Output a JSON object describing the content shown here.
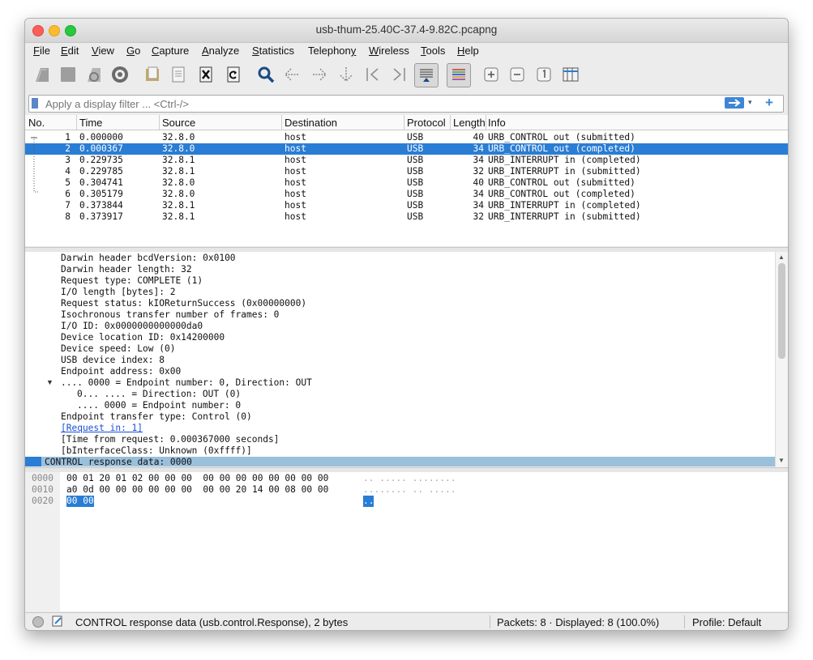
{
  "window": {
    "title": "usb-thum-25.40C-37.4-9.82C.pcapng"
  },
  "menu": [
    {
      "label": "File",
      "u": "F",
      "rest": "ile"
    },
    {
      "label": "Edit",
      "u": "E",
      "rest": "dit"
    },
    {
      "label": "View",
      "u": "V",
      "rest": "iew"
    },
    {
      "label": "Go",
      "u": "G",
      "rest": "o"
    },
    {
      "label": "Capture",
      "u": "C",
      "rest": "apture"
    },
    {
      "label": "Analyze",
      "u": "A",
      "rest": "nalyze"
    },
    {
      "label": "Statistics",
      "u": "S",
      "rest": "tatistics"
    },
    {
      "label": "Telephony",
      "u": "",
      "rest": "Telephon",
      "u2": "y"
    },
    {
      "label": "Wireless",
      "u": "W",
      "rest": "ireless"
    },
    {
      "label": "Tools",
      "u": "T",
      "rest": "ools"
    },
    {
      "label": "Help",
      "u": "H",
      "rest": "elp"
    }
  ],
  "toolbar_icons": [
    "start-capture-icon",
    "stop-capture-icon",
    "restart-capture-icon",
    "capture-options-icon",
    "open-file-icon",
    "save-file-icon",
    "close-file-icon",
    "reload-file-icon",
    "find-packet-icon",
    "go-back-icon",
    "go-forward-icon",
    "go-to-packet-icon",
    "first-packet-icon",
    "last-packet-icon",
    "auto-scroll-icon",
    "colorize-icon",
    "zoom-in-icon",
    "zoom-out-icon",
    "normal-size-icon",
    "resize-columns-icon"
  ],
  "filter": {
    "placeholder": "Apply a display filter ... <Ctrl-/>"
  },
  "packet_list": {
    "columns": [
      "No.",
      "Time",
      "Source",
      "Destination",
      "Protocol",
      "Length",
      "Info"
    ],
    "rows": [
      {
        "no": "1",
        "time": "0.000000",
        "src": "32.8.0",
        "dst": "host",
        "proto": "USB",
        "len": "40",
        "info": "URB_CONTROL out (submitted)"
      },
      {
        "no": "2",
        "time": "0.000367",
        "src": "32.8.0",
        "dst": "host",
        "proto": "USB",
        "len": "34",
        "info": "URB_CONTROL out (completed)"
      },
      {
        "no": "3",
        "time": "0.229735",
        "src": "32.8.1",
        "dst": "host",
        "proto": "USB",
        "len": "34",
        "info": "URB_INTERRUPT in (completed)"
      },
      {
        "no": "4",
        "time": "0.229785",
        "src": "32.8.1",
        "dst": "host",
        "proto": "USB",
        "len": "32",
        "info": "URB_INTERRUPT in (submitted)"
      },
      {
        "no": "5",
        "time": "0.304741",
        "src": "32.8.0",
        "dst": "host",
        "proto": "USB",
        "len": "40",
        "info": "URB_CONTROL out (submitted)"
      },
      {
        "no": "6",
        "time": "0.305179",
        "src": "32.8.0",
        "dst": "host",
        "proto": "USB",
        "len": "34",
        "info": "URB_CONTROL out (completed)"
      },
      {
        "no": "7",
        "time": "0.373844",
        "src": "32.8.1",
        "dst": "host",
        "proto": "USB",
        "len": "34",
        "info": "URB_INTERRUPT in (completed)"
      },
      {
        "no": "8",
        "time": "0.373917",
        "src": "32.8.1",
        "dst": "host",
        "proto": "USB",
        "len": "32",
        "info": "URB_INTERRUPT in (submitted)"
      }
    ],
    "selected_row": 2
  },
  "details": {
    "lines": [
      "Darwin header bcdVersion: 0x0100",
      "Darwin header length: 32",
      "Request type: COMPLETE (1)",
      "I/O length [bytes]: 2",
      "Request status: kIOReturnSuccess (0x00000000)",
      "Isochronous transfer number of frames: 0",
      "I/O ID: 0x0000000000000da0",
      "Device location ID: 0x14200000",
      "Device speed: Low (0)",
      "USB device index: 8",
      "Endpoint address: 0x00",
      ".... 0000 = Endpoint number: 0, Direction: OUT",
      "0... .... = Direction: OUT (0)",
      ".... 0000 = Endpoint number: 0",
      "Endpoint transfer type: Control (0)",
      "[Request in: 1]",
      "[Time from request: 0.000367000 seconds]",
      "[bInterfaceClass: Unknown (0xffff)]",
      "CONTROL response data: 0000"
    ]
  },
  "bytes": {
    "rows": [
      {
        "offset": "0000",
        "hex": "00 01 20 01 02 00 00 00  00 00 00 00 00 00 00 00",
        "ascii": ".. ..... ........"
      },
      {
        "offset": "0010",
        "hex": "a0 0d 00 00 00 00 00 00  00 00 20 14 00 08 00 00",
        "ascii": "........ .. ....."
      },
      {
        "offset": "0020",
        "hex": "00 00",
        "ascii": ".."
      }
    ]
  },
  "status": {
    "field": "CONTROL response data (usb.control.Response), 2 bytes",
    "packets": "Packets: 8 · Displayed: 8 (100.0%)",
    "profile": "Profile: Default"
  }
}
